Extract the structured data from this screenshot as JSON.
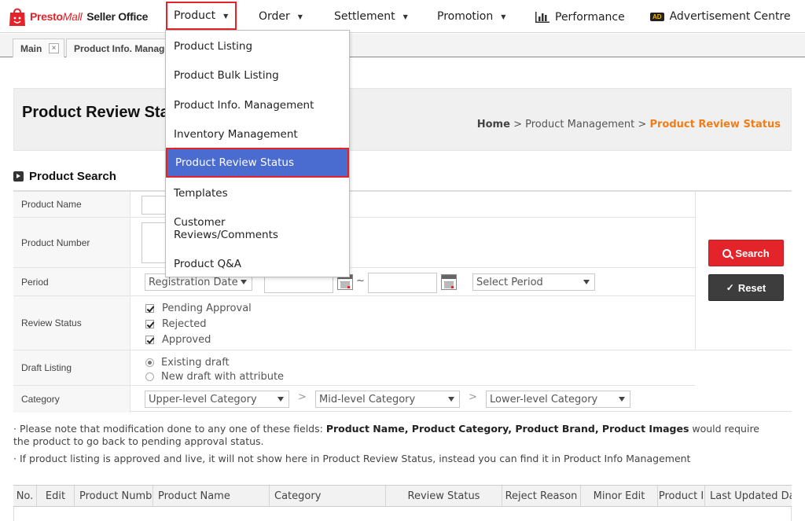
{
  "brand": {
    "logo_presto": "Presto",
    "logo_mall": "Mall",
    "office": "Seller Office"
  },
  "nav": {
    "product": "Product",
    "order": "Order",
    "settlement": "Settlement",
    "promotion": "Promotion",
    "performance": "Performance",
    "ad_badge": "AD",
    "advertisement": "Advertisement Centre"
  },
  "tabs": {
    "main": "Main",
    "close": "×",
    "info": "Product Info. Manage"
  },
  "menu": {
    "items": [
      "Product Listing",
      "Product Bulk Listing",
      "Product Info. Management",
      "Inventory Management",
      "Product Review Status",
      "Templates",
      "Customer Reviews/Comments",
      "Product Q&A"
    ]
  },
  "page": {
    "title": "Product Review Status",
    "crumb_home": "Home",
    "crumb_sep": ">",
    "crumb_mid": "Product Management",
    "crumb_current": "Product Review Status"
  },
  "search": {
    "heading": "Product Search",
    "labels": {
      "product_name": "Product Name",
      "product_number": "Product Number",
      "period": "Period",
      "review_status": "Review Status",
      "draft_listing": "Draft Listing",
      "category": "Category"
    },
    "period_type": "Registration Date",
    "tilde": "~",
    "select_period": "Select Period",
    "review_options": [
      "Pending Approval",
      "Rejected",
      "Approved"
    ],
    "draft_options": [
      "Existing draft",
      "New draft with attribute"
    ],
    "category_upper": "Upper-level Category",
    "category_mid": "Mid-level Category",
    "category_lower": "Lower-level Category",
    "chevron": ">",
    "search_btn": "Search",
    "reset_check": "✓",
    "reset_btn": "Reset"
  },
  "notes": {
    "n1_pre": "Please note that modification done to any one of these fields: ",
    "n1_bold": "Product Name, Product Category, Product Brand, Product Images",
    "n1_post": " would require the product to go back to pending approval status.",
    "n2": "If product listing is approved and live, it will not show here in Product Review Status, instead you can find it in Product Info Management",
    "bullet": "·"
  },
  "table": {
    "headers": [
      "No.",
      "Edit",
      "Product Numbe",
      "Product Name",
      "Category",
      "Review Status",
      "Reject Reason",
      "Minor Edit",
      "Product I",
      "Last Updated Da"
    ]
  },
  "colors": {
    "brand_red": "#e2232a",
    "active_blue": "#4a6cd0",
    "crumb_orange": "#f07d18"
  }
}
